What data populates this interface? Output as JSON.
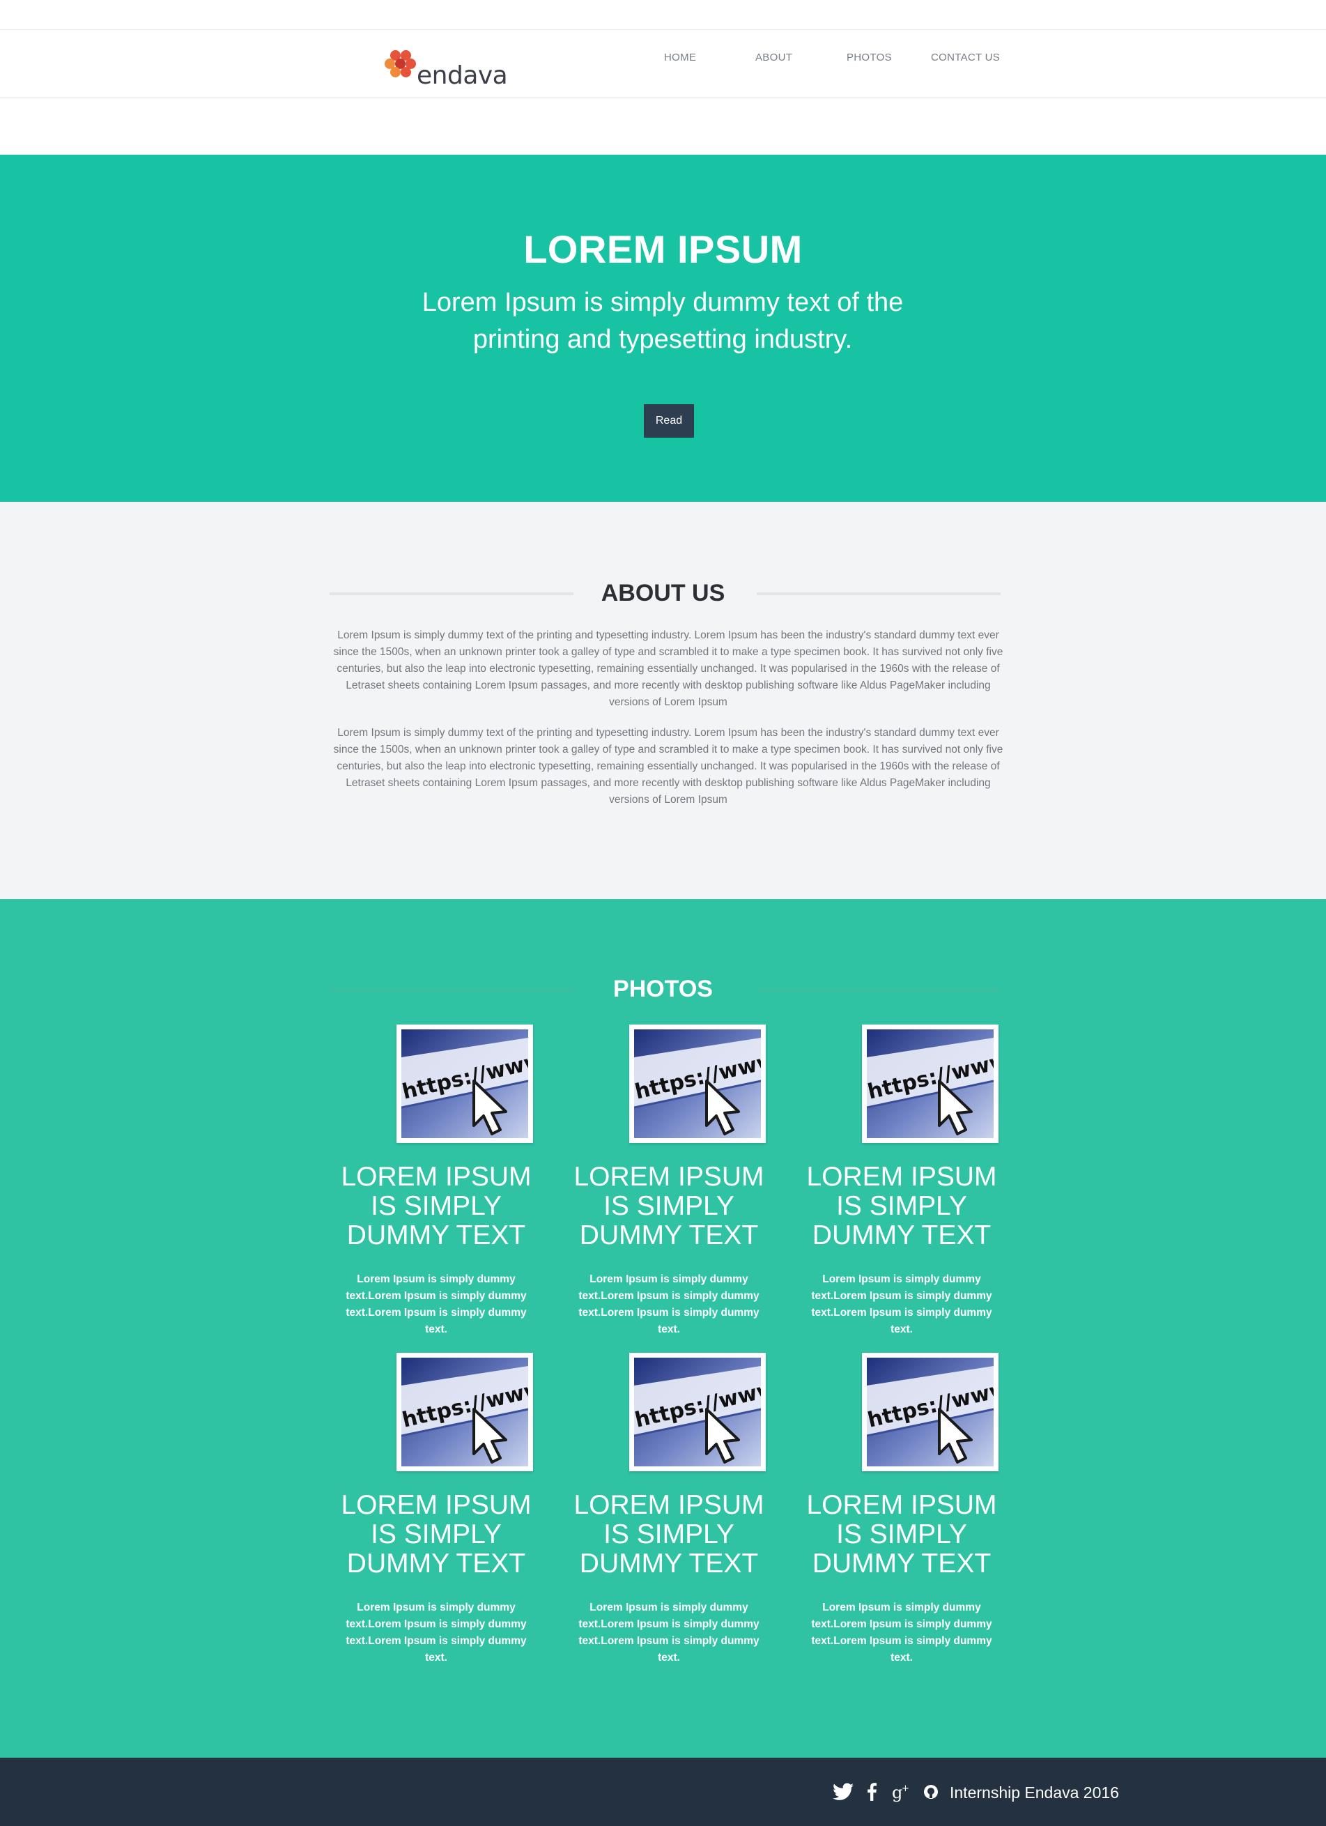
{
  "brand": {
    "name": "endava",
    "dot_colors": [
      "#e5533a",
      "#f08a3a",
      "#c9362b"
    ]
  },
  "nav": {
    "items": [
      {
        "label": "HOME"
      },
      {
        "label": "ABOUT"
      },
      {
        "label": "PHOTOS"
      },
      {
        "label": "CONTACT US"
      }
    ]
  },
  "hero": {
    "title": "LOREM IPSUM",
    "subtitle": "Lorem Ipsum is simply dummy text of the printing and typesetting industry.",
    "button_label": "Read",
    "background": "#17c3a3"
  },
  "about": {
    "title": "ABOUT US",
    "paragraphs": [
      "Lorem Ipsum is simply dummy text of the printing and typesetting industry. Lorem Ipsum has been the industry's standard dummy text ever since the 1500s, when an unknown printer took a galley of type and scrambled it to make a type specimen book. It has survived not only five centuries, but also the leap into electronic typesetting, remaining essentially unchanged. It was popularised in the 1960s with the release of Letraset sheets containing Lorem Ipsum passages, and more recently with desktop publishing software like Aldus PageMaker including versions of Lorem Ipsum",
      "Lorem Ipsum is simply dummy text of the printing and typesetting industry. Lorem Ipsum has been the industry's standard dummy text ever since the 1500s, when an unknown printer took a galley of type and scrambled it to make a type specimen book. It has survived not only five centuries, but also the leap into electronic typesetting, remaining essentially unchanged. It was popularised in the 1960s with the release of Letraset sheets containing Lorem Ipsum passages, and more recently with desktop publishing software like Aldus PageMaker including versions of Lorem Ipsum"
    ]
  },
  "photos": {
    "title": "PHOTOS",
    "background": "#2fc3a4",
    "image_text": "https://www",
    "cards": [
      {
        "title": "LOREM IPSUM IS SIMPLY DUMMY TEXT",
        "text": "Lorem Ipsum is simply dummy text.Lorem Ipsum is simply dummy text.Lorem Ipsum is simply dummy text."
      },
      {
        "title": "LOREM IPSUM IS SIMPLY DUMMY TEXT",
        "text": "Lorem Ipsum is simply dummy text.Lorem Ipsum is simply dummy text.Lorem Ipsum is simply dummy text."
      },
      {
        "title": "LOREM IPSUM IS SIMPLY DUMMY TEXT",
        "text": "Lorem Ipsum is simply dummy text.Lorem Ipsum is simply dummy text.Lorem Ipsum is simply dummy text."
      },
      {
        "title": "LOREM IPSUM IS SIMPLY DUMMY TEXT",
        "text": "Lorem Ipsum is simply dummy text.Lorem Ipsum is simply dummy text.Lorem Ipsum is simply dummy text."
      },
      {
        "title": "LOREM IPSUM IS SIMPLY DUMMY TEXT",
        "text": "Lorem Ipsum is simply dummy text.Lorem Ipsum is simply dummy text.Lorem Ipsum is simply dummy text."
      },
      {
        "title": "LOREM IPSUM IS SIMPLY DUMMY TEXT",
        "text": "Lorem Ipsum is simply dummy text.Lorem Ipsum is simply dummy text.Lorem Ipsum is simply dummy text."
      }
    ]
  },
  "footer": {
    "text": "Internship Endava 2016",
    "background": "#243140",
    "social_icons": [
      "twitter-icon",
      "facebook-icon",
      "google-plus-icon",
      "github-icon"
    ]
  }
}
